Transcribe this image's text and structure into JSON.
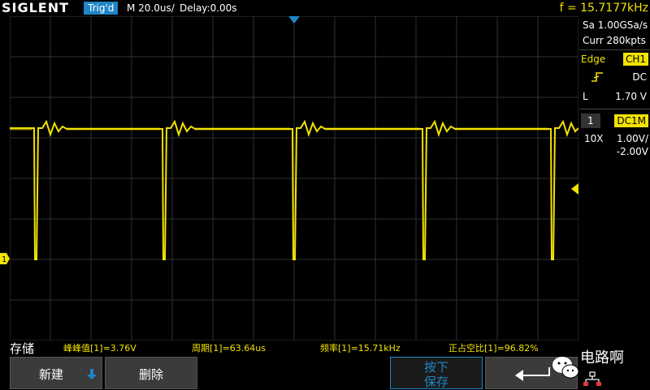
{
  "top": {
    "brand": "SIGLENT",
    "trigger_state": "Trig'd",
    "timebase": "M 20.0us/",
    "delay": "Delay:0.00s",
    "frequency": "f = 15.7177kHz"
  },
  "right_panel": {
    "sample_rate": "Sa 1.00GSa/s",
    "memory_depth": "Curr 280kpts",
    "trigger_type_label": "Edge",
    "trigger_source": "CH1",
    "trigger_slope_icon": "rising-edge-icon",
    "trigger_coupling": "DC",
    "trigger_level_label": "L",
    "trigger_level": "1.70 V",
    "channel_number": "1",
    "channel_coupling": "DC1M",
    "probe": "10X",
    "volts_per_div": "1.00V/",
    "offset": "-2.00V"
  },
  "measurements": {
    "menu_title": "存储",
    "items": [
      {
        "text": "峰峰值[1]=3.76V"
      },
      {
        "text": "周期[1]=63.64us"
      },
      {
        "text": "频率[1]=15.71kHz"
      },
      {
        "text": "正占空比[1]=96.82%"
      }
    ]
  },
  "softkeys": {
    "new_label": "新建",
    "delete_label": "删除",
    "press_to_save_top": "按下",
    "press_to_save_bottom": "保存",
    "back_icon": "return-arrow-icon"
  },
  "watermark": {
    "brand": "电路啊",
    "icon": "wechat-icon"
  },
  "colors": {
    "trace": "#f2e300",
    "trigger_marker": "#1e86c8",
    "grid": "#2f2f2f",
    "softkey_bg": "#3b3b3b"
  }
}
